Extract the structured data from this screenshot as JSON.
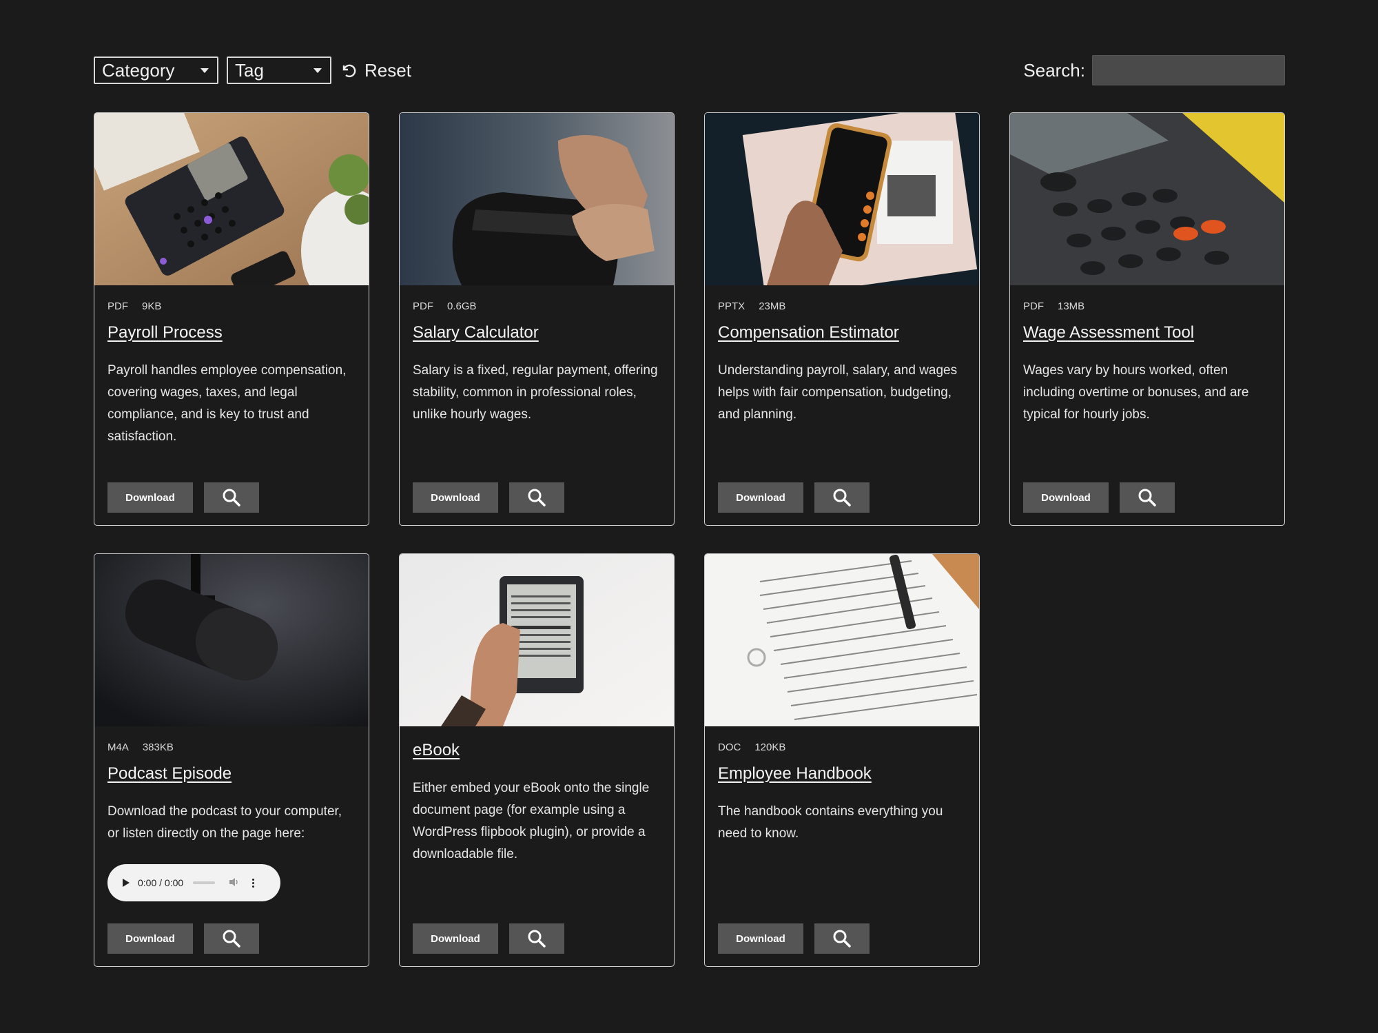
{
  "filters": {
    "category_label": "Category",
    "tag_label": "Tag",
    "reset_label": "Reset",
    "search_label": "Search:",
    "search_value": "",
    "search_placeholder": ""
  },
  "cards": [
    {
      "type": "PDF",
      "size": "9KB",
      "title": "Payroll Process",
      "description": "Payroll handles employee compensation, covering wages, taxes, and legal compliance, and is key to trust and satisfaction.",
      "download_label": "Download",
      "image_icon": "calculator-on-desk-image"
    },
    {
      "type": "PDF",
      "size": "0.6GB",
      "title": "Salary Calculator",
      "description": "Salary is a fixed, regular payment, offering stability, common in professional roles, unlike hourly wages.",
      "download_label": "Download",
      "image_icon": "wallet-image"
    },
    {
      "type": "PPTX",
      "size": "23MB",
      "title": "Compensation Estimator",
      "description": "Understanding payroll, salary, and wages helps with fair compensation, budgeting, and planning.",
      "download_label": "Download",
      "image_icon": "phone-calculator-image"
    },
    {
      "type": "PDF",
      "size": "13MB",
      "title": "Wage Assessment Tool",
      "description": "Wages vary by hours worked, often including overtime or bonuses, and are typical for hourly jobs.",
      "download_label": "Download",
      "image_icon": "scientific-calculator-image"
    },
    {
      "type": "M4A",
      "size": "383KB",
      "title": "Podcast Episode",
      "description": "Download the podcast to your computer, or listen directly on the page here:",
      "download_label": "Download",
      "image_icon": "microphone-image",
      "audio_time": "0:00 / 0:00"
    },
    {
      "title": "eBook",
      "description": "Either embed your eBook onto the single document page (for example using a WordPress flipbook plugin), or provide a downloadable file.",
      "download_label": "Download",
      "image_icon": "ereader-image"
    },
    {
      "type": "DOC",
      "size": "120KB",
      "title": "Employee Handbook",
      "description": "The handbook contains everything you need to know.",
      "download_label": "Download",
      "image_icon": "handbook-document-image"
    }
  ],
  "colors": {
    "background": "#1b1b1c",
    "button": "#555555",
    "text": "#e8e8e8"
  }
}
